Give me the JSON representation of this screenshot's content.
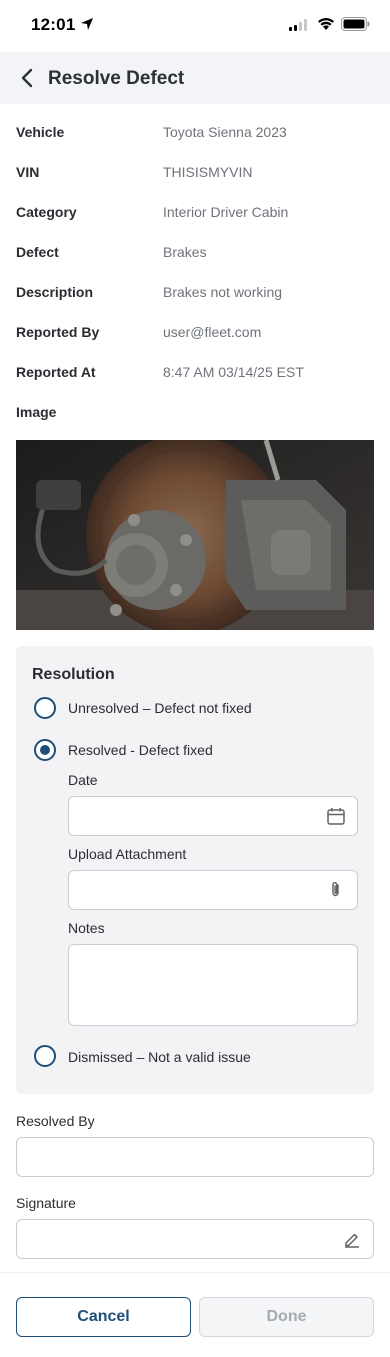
{
  "status_bar": {
    "time": "12:01"
  },
  "header": {
    "title": "Resolve Defect"
  },
  "details": [
    {
      "label": "Vehicle",
      "value": "Toyota Sienna 2023"
    },
    {
      "label": "VIN",
      "value": "THISISMYVIN"
    },
    {
      "label": "Category",
      "value": "Interior Driver Cabin"
    },
    {
      "label": "Defect",
      "value": "Brakes"
    },
    {
      "label": "Description",
      "value": "Brakes not working"
    },
    {
      "label": "Reported By",
      "value": "user@fleet.com"
    },
    {
      "label": "Reported At",
      "value": "8:47 AM 03/14/25 EST"
    }
  ],
  "image_label": "Image",
  "resolution": {
    "title": "Resolution",
    "options": [
      {
        "label": "Unresolved – Defect not fixed",
        "selected": false
      },
      {
        "label": "Resolved - Defect fixed",
        "selected": true
      },
      {
        "label": "Dismissed – Not a valid issue",
        "selected": false
      }
    ],
    "date_label": "Date",
    "date_value": "",
    "attachment_label": "Upload Attachment",
    "attachment_value": "",
    "notes_label": "Notes",
    "notes_value": ""
  },
  "resolved_by": {
    "label": "Resolved By",
    "value": ""
  },
  "signature": {
    "label": "Signature",
    "value": ""
  },
  "footer": {
    "cancel_label": "Cancel",
    "done_label": "Done"
  },
  "colors": {
    "primary": "#1f4e79",
    "header_bg": "#f3f4f7",
    "card_bg": "#f3f3f5"
  },
  "icons": {
    "back": "chevron-left-icon",
    "date": "calendar-icon",
    "attachment": "paperclip-icon",
    "signature": "pen-icon"
  }
}
